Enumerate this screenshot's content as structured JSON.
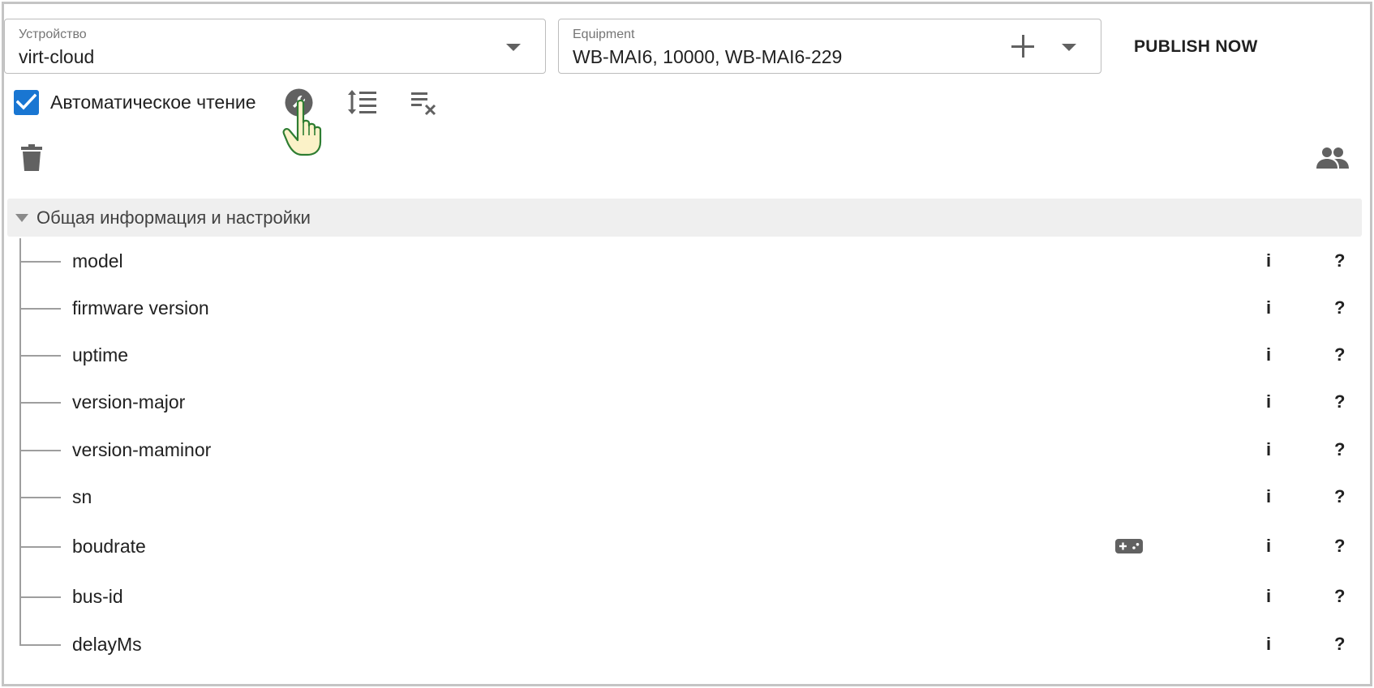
{
  "device": {
    "label": "Устройство",
    "value": "virt-cloud"
  },
  "equipment": {
    "label": "Equipment",
    "value": "WB-MAI6, 10000, WB-MAI6-229"
  },
  "publish_label": "PUBLISH NOW",
  "toolbar": {
    "auto_read_label": "Автоматическое чтение",
    "auto_read_checked": true,
    "icons": [
      "wrench-icon",
      "sort-icon",
      "clear-list-icon",
      "trash-icon",
      "people-icon"
    ]
  },
  "colors": {
    "accent": "#1976d2",
    "icon": "#616161",
    "group_bg": "#efefef"
  },
  "group": {
    "title": "Общая информация и настройки",
    "items": [
      {
        "name": "model",
        "info": "i",
        "help": "?"
      },
      {
        "name": "firmware version",
        "info": "i",
        "help": "?"
      },
      {
        "name": "uptime",
        "info": "i",
        "help": "?"
      },
      {
        "name": "version-major",
        "info": "i",
        "help": "?"
      },
      {
        "name": "version-maminor",
        "info": "i",
        "help": "?"
      },
      {
        "name": "sn",
        "info": "i",
        "help": "?"
      },
      {
        "name": "boudrate",
        "info": "i",
        "help": "?",
        "extra_icon": "gamepad-icon"
      },
      {
        "name": "bus-id",
        "info": "i",
        "help": "?"
      },
      {
        "name": "delayMs",
        "info": "i",
        "help": "?"
      }
    ]
  }
}
